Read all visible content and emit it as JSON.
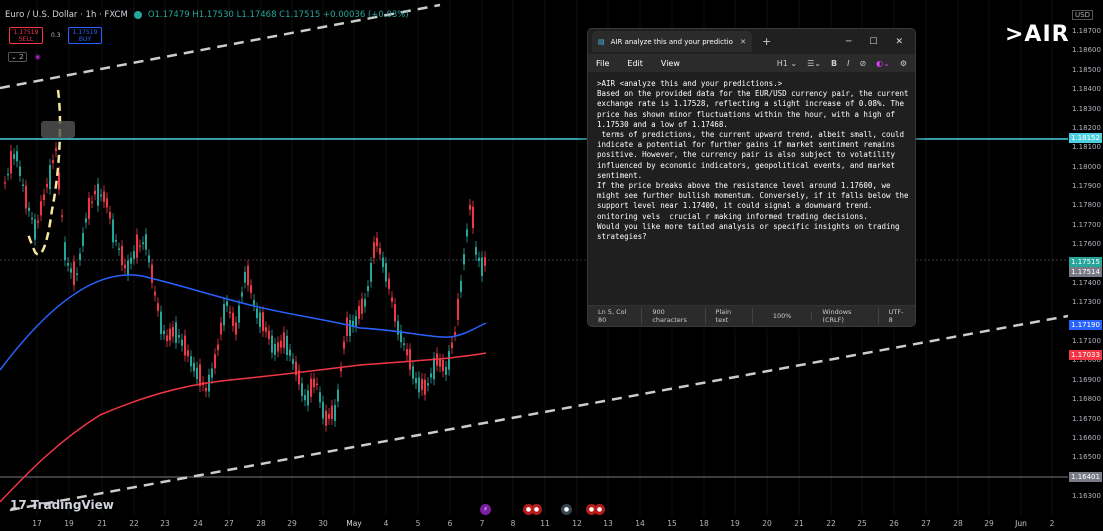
{
  "symbol": {
    "name": "Euro / U.S. Dollar · 1h · FXCM",
    "ohlc": "O1.17479 H1.17530 L1.17468 C1.17515 +0.00036 (+0.03%)",
    "sell_price": "1.17519",
    "sell_label": "SELL",
    "spread": "0.3",
    "buy_price": "1.17519",
    "buy_label": "BUY",
    "indicator_count": "2"
  },
  "price_axis": {
    "currency": "USD",
    "ticks": [
      "1.18700",
      "1.18600",
      "1.18500",
      "1.18400",
      "1.18300",
      "1.18200",
      "1.18100",
      "1.18000",
      "1.17900",
      "1.17800",
      "1.17700",
      "1.17600",
      "1.17400",
      "1.17300",
      "1.17100",
      "1.17000",
      "1.16900",
      "1.16800",
      "1.16700",
      "1.16600",
      "1.16500",
      "1.16400",
      "1.16300"
    ],
    "tags": [
      {
        "value": "1.18152",
        "color": "#4dd0e1"
      },
      {
        "value": "1.17515",
        "color": "#26a69a"
      },
      {
        "value": "1.17514",
        "color": "#787b86"
      },
      {
        "value": "1.17190",
        "color": "#2962ff"
      },
      {
        "value": "1.17033",
        "color": "#f23645"
      },
      {
        "value": "1.16401",
        "color": "#787b86"
      }
    ]
  },
  "time_axis": [
    "17",
    "19",
    "21",
    "22",
    "23",
    "24",
    "27",
    "28",
    "29",
    "30",
    "May",
    "4",
    "5",
    "6",
    "7",
    "8",
    "11",
    "12",
    "13",
    "14",
    "15",
    "18",
    "19",
    "20",
    "21",
    "22",
    "25",
    "26",
    "27",
    "28",
    "29",
    "Jun",
    "2"
  ],
  "branding": {
    "tradingview": "TradingView",
    "air": ">AIR"
  },
  "colors": {
    "up": "#26a69a",
    "down": "#f23645",
    "ma_blue": "#2962ff",
    "ma_red": "#f23645",
    "resistance": "#4dd0e1"
  },
  "notepad": {
    "tab_title": "AIR analyze this and your predictio",
    "menu": {
      "file": "File",
      "edit": "Edit",
      "view": "View",
      "heading": "H1"
    },
    "content": ">AIR <analyze this and your predictions.>\nBased on the provided data for the EUR/USD currency pair, the current exchange rate is 1.17528, reflecting a slight increase of 0.08%. The price has shown minor fluctuations within the hour, with a high of 1.17530 and a low of 1.17468.\n terms of predictions, the current upward trend, albeit small, could indicate a potential for further gains if market sentiment remains positive. However, the currency pair is also subject to volatility influenced by economic indicators, geopolitical events, and market sentiment.\nIf the price breaks above the resistance level around 1.17600, we might see further bullish momentum. Conversely, if it falls below the support level near 1.17400, it could signal a downward trend.\nonitoring vels  crucial r making informed trading decisions.\nWould you like more tailed analysis or specific insights on trading strategies?",
    "status": {
      "position": "Ln 5, Col 80",
      "chars": "900 characters",
      "format": "Plain text",
      "zoom": "100%",
      "eol": "Windows (CRLF)",
      "encoding": "UTF-8"
    }
  }
}
